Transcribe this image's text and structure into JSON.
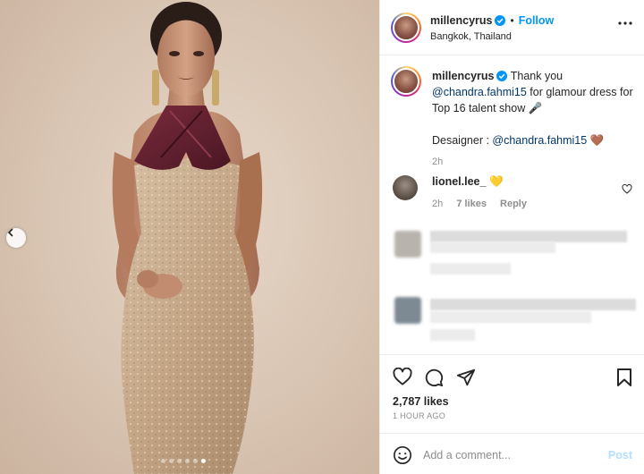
{
  "post": {
    "username": "millencyrus",
    "follow_label": "Follow",
    "separator": "•",
    "location": "Bangkok, Thailand",
    "more_icon": "more-horizontal-icon",
    "carousel": {
      "dot_count": 6,
      "active_index": 5
    }
  },
  "caption": {
    "username": "millencyrus",
    "text_1": "Thank you",
    "mention_1": "@chandra.fahmi15",
    "text_2": " for glamour dress for Top 16 talent show ",
    "mic_icon": "🎤",
    "designer_label": "Desaigner : ",
    "mention_2": "@chandra.fahmi15",
    "heart_icon": "🤎",
    "time": "2h"
  },
  "comments": [
    {
      "username": "lionel.lee_",
      "emoji": "💛",
      "time": "2h",
      "likes": "7 likes",
      "reply": "Reply"
    }
  ],
  "actions": {
    "likes": "2,787 likes",
    "timestamp": "1 HOUR AGO"
  },
  "add_comment": {
    "placeholder": "Add a comment...",
    "post_label": "Post"
  },
  "colors": {
    "accent": "#0095f6",
    "mention": "#00376b",
    "muted": "#8e8e8e",
    "border": "#efefef",
    "dress_halter": "#5c1f2e",
    "dress_body": "#c9ad8e"
  }
}
